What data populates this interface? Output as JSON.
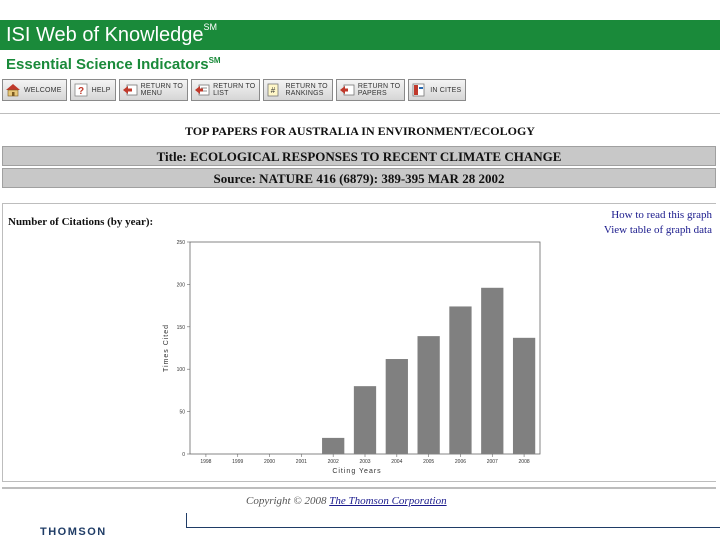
{
  "brand": {
    "title": "ISI Web of Knowledge",
    "title_mark": "SM",
    "subtitle": "Essential Science Indicators",
    "subtitle_mark": "SM"
  },
  "toolbar": [
    {
      "label": "WELCOME",
      "icon": "home-icon"
    },
    {
      "label": "HELP",
      "icon": "help-icon"
    },
    {
      "label": "RETURN TO\nMENU",
      "icon": "return-menu-icon"
    },
    {
      "label": "RETURN TO\nLIST",
      "icon": "return-list-icon"
    },
    {
      "label": "RETURN TO\nRANKINGS",
      "icon": "return-rankings-icon"
    },
    {
      "label": "RETURN TO\nPAPERS",
      "icon": "return-papers-icon"
    },
    {
      "label": "IN CITES",
      "icon": "incites-icon"
    }
  ],
  "page": {
    "heading": "TOP PAPERS FOR AUSTRALIA IN ENVIRONMENT/ECOLOGY",
    "title_line": "Title: ECOLOGICAL RESPONSES TO RECENT CLIMATE CHANGE",
    "source_line": "Source: NATURE 416 (6879): 389-395 MAR 28 2002"
  },
  "graph_panel": {
    "label": "Number of Citations (by year):",
    "link_how": "How to read this graph",
    "link_table": "View table of graph data"
  },
  "chart_data": {
    "type": "bar",
    "categories": [
      "1998",
      "1999",
      "2000",
      "2001",
      "2002",
      "2003",
      "2004",
      "2005",
      "2006",
      "2007",
      "2008"
    ],
    "values": [
      0,
      0,
      0,
      0,
      19,
      80,
      112,
      139,
      174,
      196,
      137
    ],
    "xlabel": "Citing Years",
    "ylabel": "Times Cited",
    "ylim": [
      0,
      250
    ],
    "yticks": [
      0,
      50,
      100,
      150,
      200,
      250
    ],
    "bar_color": "#808080",
    "grid": false
  },
  "footer": {
    "copyright_prefix": "Copyright © 2008",
    "copyright_link": "The Thomson Corporation",
    "logo_text": "THOMSON"
  },
  "colors": {
    "brand_green": "#1a8a3a",
    "link_blue": "#1a1a8c",
    "bar_gray": "#c8c8c8"
  }
}
